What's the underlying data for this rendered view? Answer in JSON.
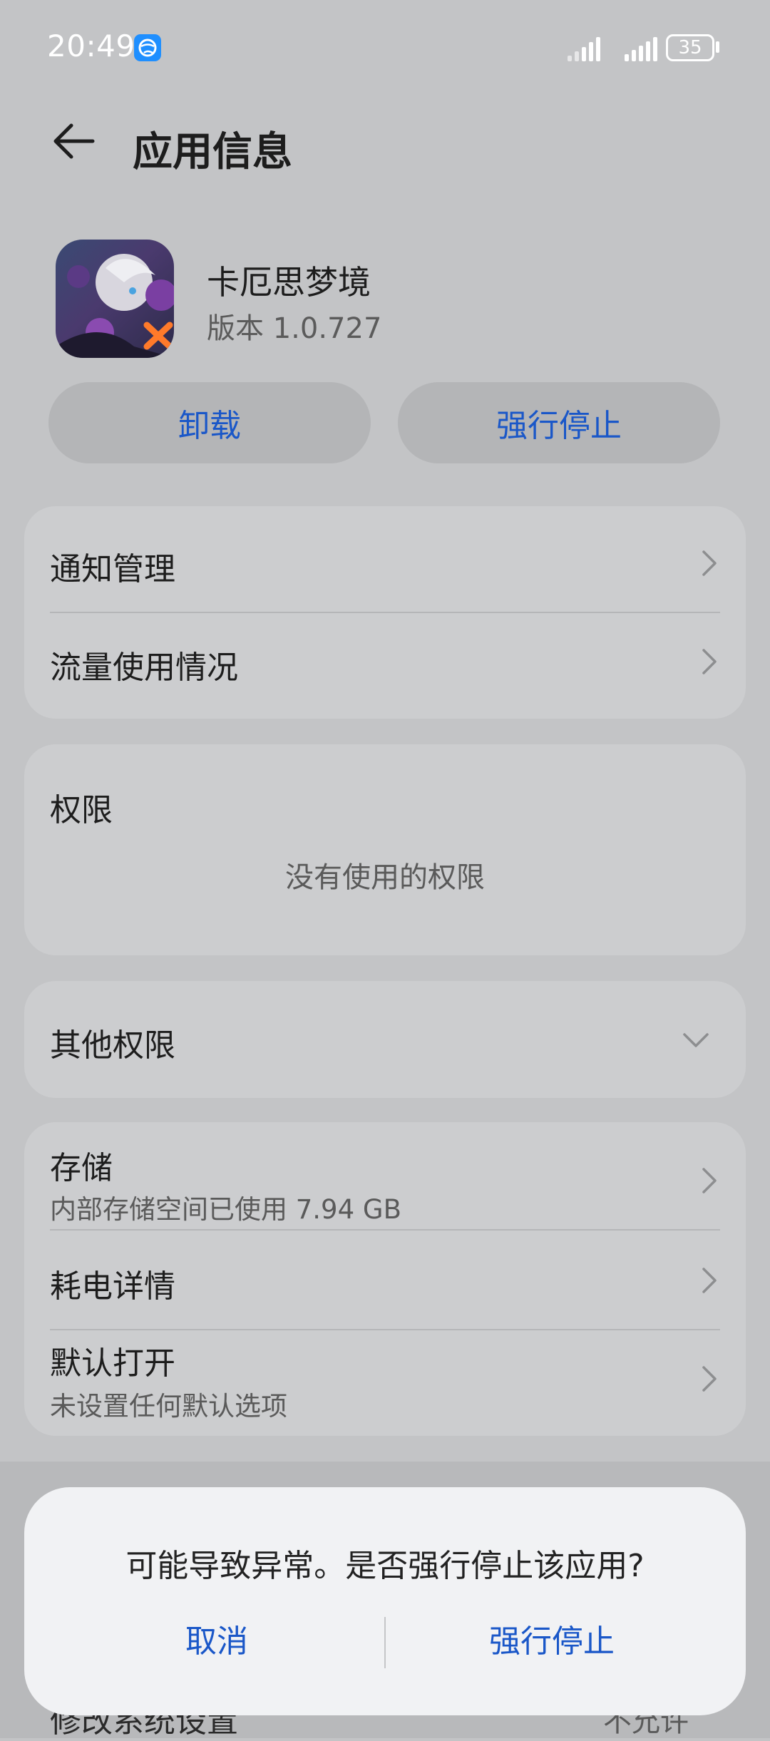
{
  "status_bar": {
    "time": "20:49",
    "battery": "35",
    "app_badge_icon": "globe-icon"
  },
  "header": {
    "title": "应用信息",
    "back_icon": "back-arrow-icon"
  },
  "app": {
    "name": "卡厄思梦境",
    "version": "版本 1.0.727"
  },
  "actions": {
    "uninstall": "卸载",
    "force_stop": "强行停止"
  },
  "rows": {
    "notification": "通知管理",
    "data_usage": "流量使用情况",
    "permissions_title": "权限",
    "permissions_empty": "没有使用的权限",
    "other_permissions": "其他权限",
    "storage_title": "存储",
    "storage_sub": "内部存储空间已使用 7.94 GB",
    "battery_usage": "耗电详情",
    "default_open_title": "默认打开",
    "default_open_sub": "未设置任何默认选项",
    "modify_system_settings": "修改系统设置",
    "modify_system_value": "不允许"
  },
  "dialog": {
    "message": "可能导致异常。是否强行停止该应用?",
    "cancel": "取消",
    "confirm": "强行停止"
  },
  "colors": {
    "accent": "#1a57c8",
    "background": "#c3c4c6",
    "card": "#cccdcf",
    "dialog": "#f1f2f4"
  }
}
